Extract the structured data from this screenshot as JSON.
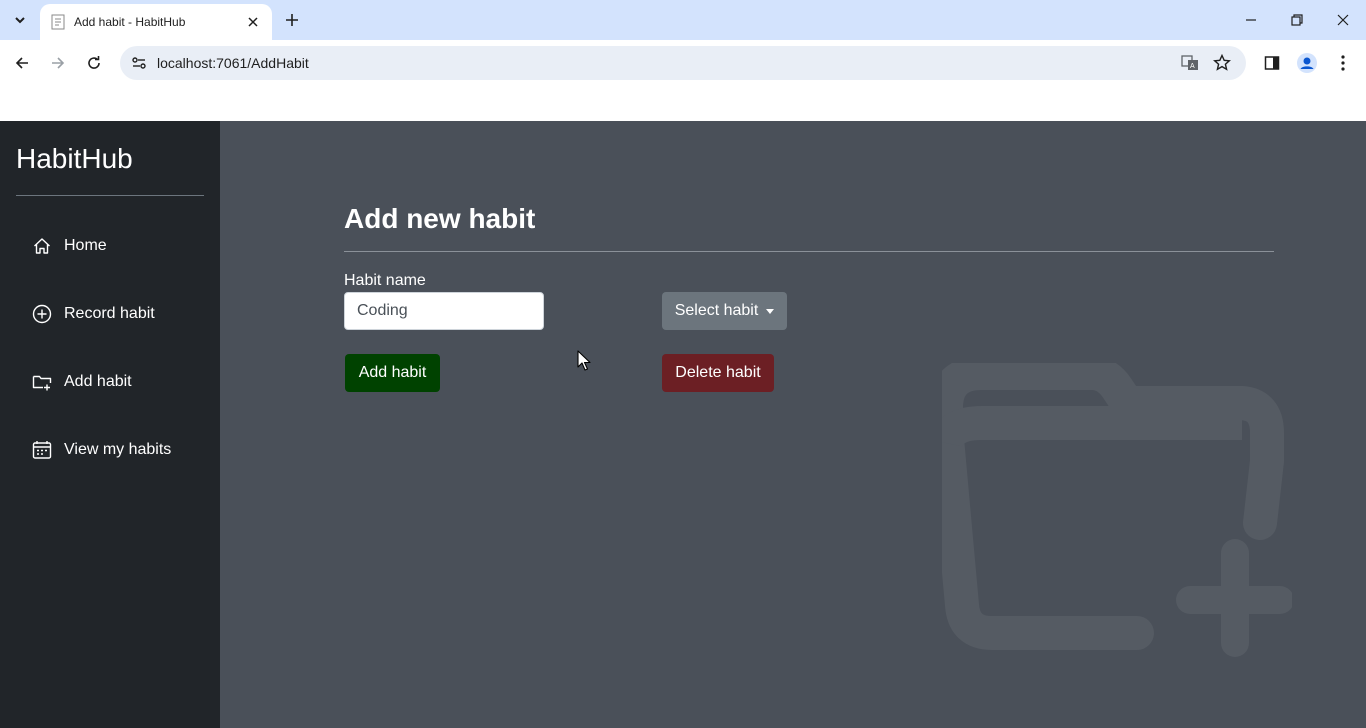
{
  "browser": {
    "tab_title": "Add habit - HabitHub",
    "url": "localhost:7061/AddHabit"
  },
  "sidebar": {
    "brand": "HabitHub",
    "items": [
      {
        "label": "Home",
        "icon": "house-icon"
      },
      {
        "label": "Record habit",
        "icon": "plus-circle-icon"
      },
      {
        "label": "Add habit",
        "icon": "folder-plus-icon"
      },
      {
        "label": "View my habits",
        "icon": "calendar-icon"
      }
    ]
  },
  "main": {
    "title": "Add new habit",
    "field_label": "Habit name",
    "field_value": "Coding",
    "select_button": "Select habit",
    "add_button": "Add habit",
    "delete_button": "Delete habit"
  },
  "colors": {
    "sidebar_bg": "#212529",
    "main_bg": "#4a5059",
    "add_button": "#004200",
    "delete_button": "#6c1f24",
    "select_button": "#6c757d"
  }
}
